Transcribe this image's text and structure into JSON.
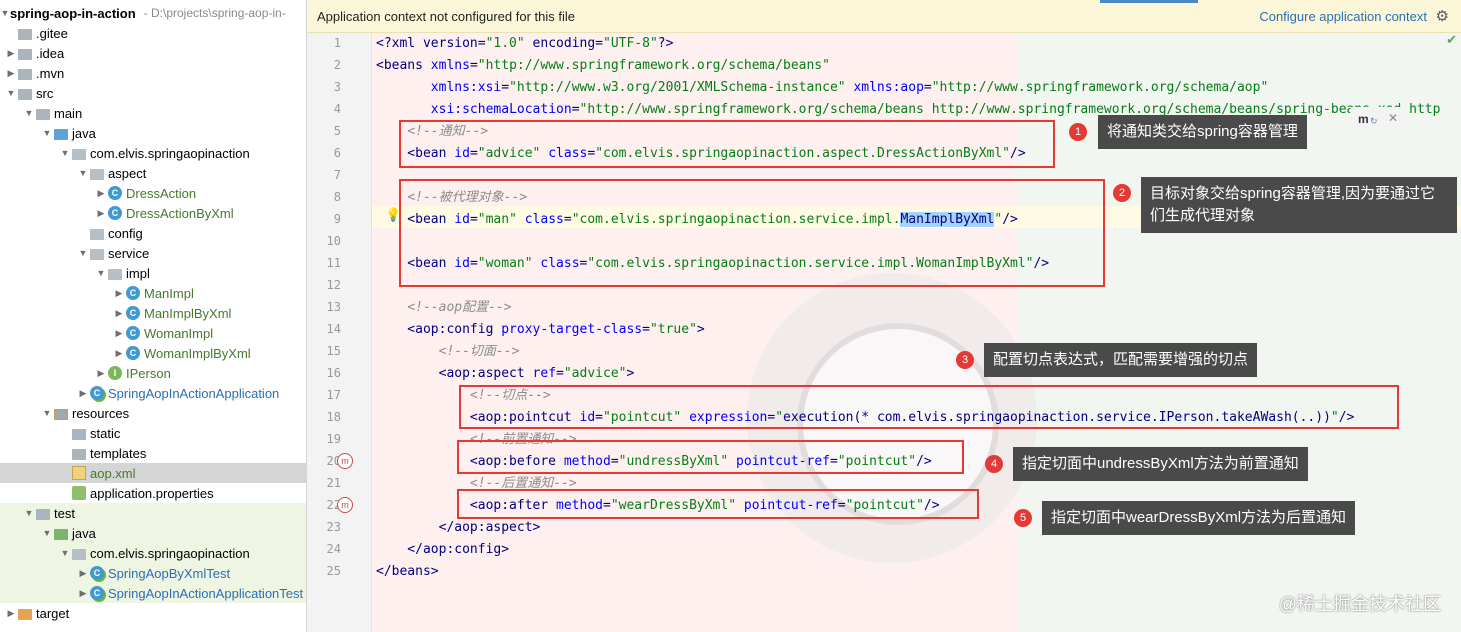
{
  "project": {
    "name": "spring-aop-in-action",
    "path": "- D:\\projects\\spring-aop-in-"
  },
  "tree": [
    {
      "label": ".gitee",
      "depth": 0,
      "arrow": "",
      "icon": "folder",
      "tone": ""
    },
    {
      "label": ".idea",
      "depth": 0,
      "arrow": "▶",
      "icon": "folder",
      "tone": ""
    },
    {
      "label": ".mvn",
      "depth": 0,
      "arrow": "▶",
      "icon": "folder",
      "tone": ""
    },
    {
      "label": "src",
      "depth": 0,
      "arrow": "▼",
      "icon": "folder",
      "tone": ""
    },
    {
      "label": "main",
      "depth": 1,
      "arrow": "▼",
      "icon": "folder",
      "tone": ""
    },
    {
      "label": "java",
      "depth": 2,
      "arrow": "▼",
      "icon": "folder-blue",
      "tone": ""
    },
    {
      "label": "com.elvis.springaopinaction",
      "depth": 3,
      "arrow": "▼",
      "icon": "pkg",
      "tone": ""
    },
    {
      "label": "aspect",
      "depth": 4,
      "arrow": "▼",
      "icon": "pkg",
      "tone": ""
    },
    {
      "label": "DressAction",
      "depth": 5,
      "arrow": "▶",
      "icon": "class",
      "tone": "green"
    },
    {
      "label": "DressActionByXml",
      "depth": 5,
      "arrow": "▶",
      "icon": "class",
      "tone": "green"
    },
    {
      "label": "config",
      "depth": 4,
      "arrow": "",
      "icon": "pkg",
      "tone": ""
    },
    {
      "label": "service",
      "depth": 4,
      "arrow": "▼",
      "icon": "pkg",
      "tone": ""
    },
    {
      "label": "impl",
      "depth": 5,
      "arrow": "▼",
      "icon": "pkg",
      "tone": ""
    },
    {
      "label": "ManImpl",
      "depth": 6,
      "arrow": "▶",
      "icon": "class",
      "tone": "green"
    },
    {
      "label": "ManImplByXml",
      "depth": 6,
      "arrow": "▶",
      "icon": "class",
      "tone": "green"
    },
    {
      "label": "WomanImpl",
      "depth": 6,
      "arrow": "▶",
      "icon": "class",
      "tone": "green"
    },
    {
      "label": "WomanImplByXml",
      "depth": 6,
      "arrow": "▶",
      "icon": "class",
      "tone": "green"
    },
    {
      "label": "IPerson",
      "depth": 5,
      "arrow": "▶",
      "icon": "interface",
      "tone": "green"
    },
    {
      "label": "SpringAopInActionApplication",
      "depth": 4,
      "arrow": "▶",
      "icon": "boot",
      "tone": "blue"
    },
    {
      "label": "resources",
      "depth": 2,
      "arrow": "▼",
      "icon": "folder-res",
      "tone": ""
    },
    {
      "label": "static",
      "depth": 3,
      "arrow": "",
      "icon": "folder",
      "tone": ""
    },
    {
      "label": "templates",
      "depth": 3,
      "arrow": "",
      "icon": "folder",
      "tone": ""
    },
    {
      "label": "aop.xml",
      "depth": 3,
      "arrow": "",
      "icon": "xml",
      "tone": "green",
      "selected": true
    },
    {
      "label": "application.properties",
      "depth": 3,
      "arrow": "",
      "icon": "props",
      "tone": ""
    },
    {
      "label": "test",
      "depth": 1,
      "arrow": "▼",
      "icon": "folder",
      "tone": "",
      "greenbg": true
    },
    {
      "label": "java",
      "depth": 2,
      "arrow": "▼",
      "icon": "folder-green",
      "tone": "",
      "greenbg": true
    },
    {
      "label": "com.elvis.springaopinaction",
      "depth": 3,
      "arrow": "▼",
      "icon": "pkg",
      "tone": "",
      "greenbg": true
    },
    {
      "label": "SpringAopByXmlTest",
      "depth": 4,
      "arrow": "▶",
      "icon": "boot",
      "tone": "blue",
      "greenbg": true
    },
    {
      "label": "SpringAopInActionApplicationTest",
      "depth": 4,
      "arrow": "▶",
      "icon": "boot",
      "tone": "blue",
      "greenbg": true
    },
    {
      "label": "target",
      "depth": 0,
      "arrow": "▶",
      "icon": "folder-orange",
      "tone": ""
    }
  ],
  "notice": {
    "text": "Application context not configured for this file",
    "link": "Configure application context"
  },
  "line_numbers": [
    "1",
    "2",
    "3",
    "4",
    "5",
    "6",
    "7",
    "8",
    "9",
    "10",
    "11",
    "12",
    "13",
    "14",
    "15",
    "16",
    "17",
    "18",
    "19",
    "20",
    "21",
    "22",
    "23",
    "24",
    "25"
  ],
  "code": [
    [
      [
        "<?xml version=",
        "tg"
      ],
      [
        "\"1.0\"",
        "vl"
      ],
      [
        " encoding=",
        "tg"
      ],
      [
        "\"UTF-8\"",
        "vl"
      ],
      [
        "?>",
        "tg"
      ]
    ],
    [
      [
        "<beans ",
        "tg"
      ],
      [
        "xmlns",
        "at"
      ],
      [
        "=",
        "tg"
      ],
      [
        "\"http://www.springframework.org/schema/beans\"",
        "vl"
      ]
    ],
    [
      [
        "       ",
        "tg"
      ],
      [
        "xmlns:xsi",
        "at"
      ],
      [
        "=",
        "tg"
      ],
      [
        "\"http://www.w3.org/2001/XMLSchema-instance\"",
        "vl"
      ],
      [
        " ",
        "tg"
      ],
      [
        "xmlns:aop",
        "at"
      ],
      [
        "=",
        "tg"
      ],
      [
        "\"http://www.springframework.org/schema/aop\"",
        "vl"
      ]
    ],
    [
      [
        "       ",
        "tg"
      ],
      [
        "xsi:schemaLocation",
        "at"
      ],
      [
        "=",
        "tg"
      ],
      [
        "\"http://www.springframework.org/schema/beans http://www.springframework.org/schema/beans/spring-beans.xsd http",
        "vl"
      ]
    ],
    [
      [
        "    ",
        "tg"
      ],
      [
        "<!--通知-->",
        "cm"
      ]
    ],
    [
      [
        "    <bean ",
        "tg"
      ],
      [
        "id",
        "at"
      ],
      [
        "=",
        "tg"
      ],
      [
        "\"advice\"",
        "vl"
      ],
      [
        " ",
        "tg"
      ],
      [
        "class",
        "at"
      ],
      [
        "=",
        "tg"
      ],
      [
        "\"com.elvis.springaopinaction.aspect.DressActionByXml\"",
        "vl"
      ],
      [
        "/>",
        "tg"
      ]
    ],
    [
      [
        "",
        "tg"
      ]
    ],
    [
      [
        "    ",
        "tg"
      ],
      [
        "<!--被代理对象-->",
        "cm"
      ]
    ],
    [
      [
        "    <bean ",
        "tg"
      ],
      [
        "id",
        "at"
      ],
      [
        "=",
        "tg"
      ],
      [
        "\"man\"",
        "vl"
      ],
      [
        " ",
        "tg"
      ],
      [
        "class",
        "at"
      ],
      [
        "=",
        "tg"
      ],
      [
        "\"com.elvis.springaopinaction.service.impl.",
        "vl"
      ],
      [
        "ManImplByXml",
        "sel"
      ],
      [
        "\"",
        "vl"
      ],
      [
        "/>",
        "tg"
      ]
    ],
    [
      [
        "",
        "tg"
      ]
    ],
    [
      [
        "    <bean ",
        "tg"
      ],
      [
        "id",
        "at"
      ],
      [
        "=",
        "tg"
      ],
      [
        "\"woman\"",
        "vl"
      ],
      [
        " ",
        "tg"
      ],
      [
        "class",
        "at"
      ],
      [
        "=",
        "tg"
      ],
      [
        "\"com.elvis.springaopinaction.service.impl.WomanImplByXml\"",
        "vl"
      ],
      [
        "/>",
        "tg"
      ]
    ],
    [
      [
        "",
        "tg"
      ]
    ],
    [
      [
        "    ",
        "tg"
      ],
      [
        "<!--aop配置-->",
        "cm"
      ]
    ],
    [
      [
        "    <aop:config ",
        "tg"
      ],
      [
        "proxy-target-class",
        "at"
      ],
      [
        "=",
        "tg"
      ],
      [
        "\"true\"",
        "vl"
      ],
      [
        ">",
        "tg"
      ]
    ],
    [
      [
        "        ",
        "tg"
      ],
      [
        "<!--切面-->",
        "cm"
      ]
    ],
    [
      [
        "        <aop:aspect ",
        "tg"
      ],
      [
        "ref",
        "at"
      ],
      [
        "=",
        "tg"
      ],
      [
        "\"advice\"",
        "vl"
      ],
      [
        ">",
        "tg"
      ]
    ],
    [
      [
        "            ",
        "tg"
      ],
      [
        "<!--切点-->",
        "cm"
      ]
    ],
    [
      [
        "            <aop:pointcut ",
        "tg"
      ],
      [
        "id",
        "at"
      ],
      [
        "=",
        "tg"
      ],
      [
        "\"pointcut\"",
        "vl"
      ],
      [
        " ",
        "tg"
      ],
      [
        "expression",
        "at"
      ],
      [
        "=",
        "tg"
      ],
      [
        "\"",
        "vl"
      ],
      [
        "execution(* com.elvis.springaopinaction.service.IPerson.takeAWash(..))",
        "tg"
      ],
      [
        "\"",
        "vl"
      ],
      [
        "/>",
        "tg"
      ]
    ],
    [
      [
        "            ",
        "tg"
      ],
      [
        "<!--前置通知-->",
        "cm"
      ]
    ],
    [
      [
        "            <aop:before ",
        "tg"
      ],
      [
        "method",
        "at"
      ],
      [
        "=",
        "tg"
      ],
      [
        "\"undressByXml\"",
        "vl"
      ],
      [
        " ",
        "tg"
      ],
      [
        "pointcut-ref",
        "at"
      ],
      [
        "=",
        "tg"
      ],
      [
        "\"pointcut\"",
        "vl"
      ],
      [
        "/>",
        "tg"
      ]
    ],
    [
      [
        "            ",
        "tg"
      ],
      [
        "<!--后置通知-->",
        "cm"
      ]
    ],
    [
      [
        "            <aop:after ",
        "tg"
      ],
      [
        "method",
        "at"
      ],
      [
        "=",
        "tg"
      ],
      [
        "\"wearDressByXml\"",
        "vl"
      ],
      [
        " ",
        "tg"
      ],
      [
        "pointcut-ref",
        "at"
      ],
      [
        "=",
        "tg"
      ],
      [
        "\"pointcut\"",
        "vl"
      ],
      [
        "/>",
        "tg"
      ]
    ],
    [
      [
        "        </aop:aspect>",
        "tg"
      ]
    ],
    [
      [
        "    </aop:config>",
        "tg"
      ]
    ],
    [
      [
        "</beans>",
        "tg"
      ]
    ]
  ],
  "annotations": [
    {
      "num": "1",
      "text": "将通知类交给spring容器管理"
    },
    {
      "num": "2",
      "text": "目标对象交给spring容器管理,因为要通过它们生成代理对象"
    },
    {
      "num": "3",
      "text": "配置切点表达式，匹配需要增强的切点"
    },
    {
      "num": "4",
      "text": "指定切面中undressByXml方法为前置通知"
    },
    {
      "num": "5",
      "text": "指定切面中wearDressByXml方法为后置通知"
    }
  ],
  "maven_label": "m",
  "watermark": "@稀土掘金技术社区",
  "colors": {
    "annotation_red": "#e53935",
    "tooltip_bg": "#4a4a4a",
    "link_blue": "#2a6fb4",
    "notice_bg": "#fbf7d8"
  }
}
